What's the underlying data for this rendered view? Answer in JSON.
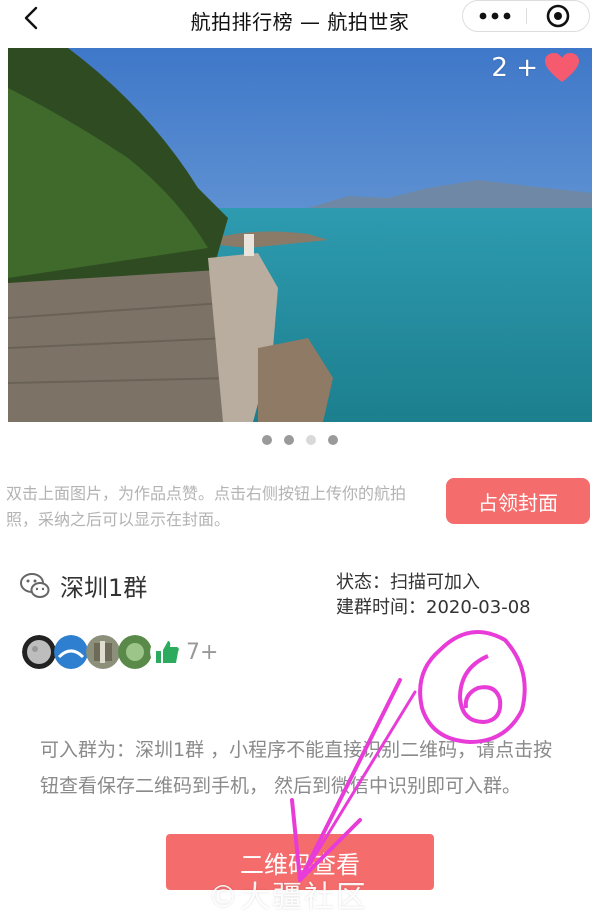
{
  "nav": {
    "title": "航拍排行榜 — 航拍世家",
    "back_icon": "chevron-left-icon",
    "more_icon": "more-dots-icon",
    "target_icon": "target-icon"
  },
  "hero": {
    "likes_count": "2 +",
    "heart_color": "#f55a6e",
    "carousel_total": 4,
    "carousel_active": 1
  },
  "hint": {
    "text": "双击上面图片，为作品点赞。点击右侧按钮上传你的航拍照，采纳之后可以显示在封面。",
    "button_label": "占领封面"
  },
  "group": {
    "icon": "wechat-icon",
    "name": "深圳1群",
    "status": "状态：扫描可加入",
    "created": "建群时间：2020-03-08"
  },
  "members": {
    "extra_count": "7+"
  },
  "description": "可入群为：深圳1群 ，小程序不能直接识别二维码，请点击按钮查看保存二维码到手机， 然后到微信中识别即可入群。",
  "qr_button_label": "二维码查看",
  "watermark": "©大疆社区",
  "annotation": {
    "label": "6",
    "color": "#e83cd8"
  },
  "colors": {
    "accent": "#f46c6c",
    "hint_text": "#b3b3b3",
    "desc_text": "#8a8a8a"
  }
}
